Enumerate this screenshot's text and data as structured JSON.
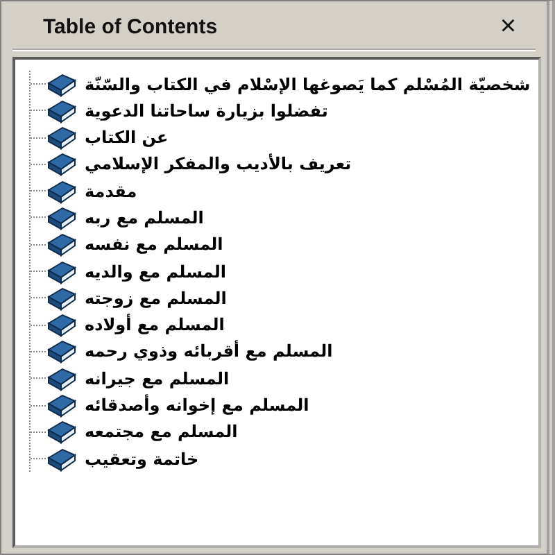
{
  "panel": {
    "title": "Table of Contents",
    "close": "×"
  },
  "tree": {
    "items": [
      {
        "label": "شخصيّة المُسْلم كما يَصوغها الإسْلام في الكتاب والسّنّة"
      },
      {
        "label": "تفضلوا بزيارة ساحاتنا الدعوية"
      },
      {
        "label": "عن الكتاب"
      },
      {
        "label": "تعريف بالأديب والمفكر الإسلامي"
      },
      {
        "label": "مقدمة"
      },
      {
        "label": "المسلم مع ربه"
      },
      {
        "label": "المسلم مع نفسه"
      },
      {
        "label": "المسلم مع والديه"
      },
      {
        "label": "المسلم مع زوجته"
      },
      {
        "label": "المسلم مع أولاده"
      },
      {
        "label": "المسلم مع أقربائه وذوي رحمه"
      },
      {
        "label": "المسلم مع جيرانه"
      },
      {
        "label": "المسلم مع إخوانه وأصدقائه"
      },
      {
        "label": "المسلم مع مجتمعه"
      },
      {
        "label": "خاتمة وتعقيب"
      }
    ]
  }
}
